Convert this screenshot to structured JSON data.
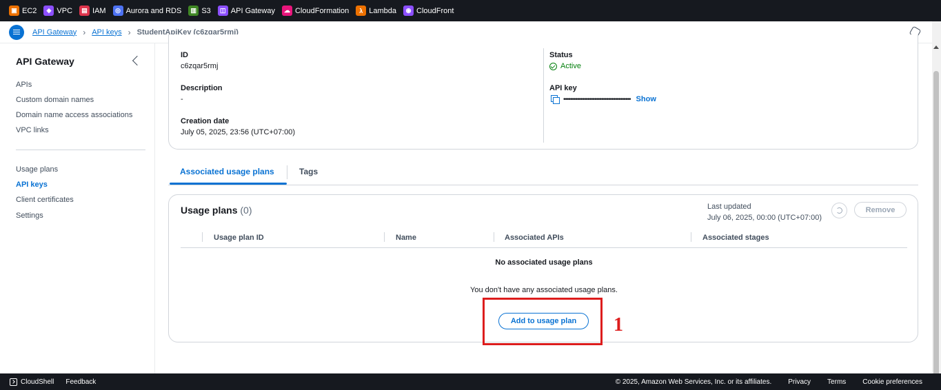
{
  "services": [
    {
      "label": "EC2",
      "icon": "ec2-icon",
      "color": "#ed7100"
    },
    {
      "label": "VPC",
      "icon": "vpc-icon",
      "color": "#8c4fff"
    },
    {
      "label": "IAM",
      "icon": "iam-icon",
      "color": "#dd344c"
    },
    {
      "label": "Aurora and RDS",
      "icon": "rds-icon",
      "color": "#4d72f3"
    },
    {
      "label": "S3",
      "icon": "s3-icon",
      "color": "#3f8624"
    },
    {
      "label": "API Gateway",
      "icon": "api-gateway-icon",
      "color": "#8c4fff"
    },
    {
      "label": "CloudFormation",
      "icon": "cloudformation-icon",
      "color": "#e7157b"
    },
    {
      "label": "Lambda",
      "icon": "lambda-icon",
      "color": "#ed7100"
    },
    {
      "label": "CloudFront",
      "icon": "cloudfront-icon",
      "color": "#8c4fff"
    }
  ],
  "breadcrumb": {
    "root": "API Gateway",
    "section": "API keys",
    "current": "StudentApiKey (c6zqar5rmj)"
  },
  "sidebar": {
    "title": "API Gateway",
    "group1": [
      "APIs",
      "Custom domain names",
      "Domain name access associations",
      "VPC links"
    ],
    "group2": [
      "Usage plans",
      "API keys",
      "Client certificates",
      "Settings"
    ],
    "active": "API keys"
  },
  "details": {
    "id_label": "ID",
    "id_value": "c6zqar5rmj",
    "description_label": "Description",
    "description_value": "-",
    "creation_label": "Creation date",
    "creation_value": "July 05, 2025, 23:56 (UTC+07:00)",
    "status_label": "Status",
    "status_value": "Active",
    "apikey_label": "API key",
    "apikey_masked": "•••••••••••••••••••••••••••••••••••••••",
    "show_label": "Show"
  },
  "tabs": [
    {
      "label": "Associated usage plans",
      "active": true
    },
    {
      "label": "Tags",
      "active": false
    }
  ],
  "usage_plans": {
    "title": "Usage plans",
    "count": "(0)",
    "last_updated_label": "Last updated",
    "last_updated_value": "July 06, 2025, 00:00 (UTC+07:00)",
    "remove_label": "Remove",
    "columns": [
      "Usage plan ID",
      "Name",
      "Associated APIs",
      "Associated stages"
    ],
    "empty_title": "No associated usage plans",
    "empty_desc": "You don't have any associated usage plans.",
    "add_label": "Add to usage plan"
  },
  "annotation": {
    "number": "1",
    "color": "#dd1d1d"
  },
  "footer": {
    "cloudshell": "CloudShell",
    "feedback": "Feedback",
    "copyright": "© 2025, Amazon Web Services, Inc. or its affiliates.",
    "privacy": "Privacy",
    "terms": "Terms",
    "cookies": "Cookie preferences"
  }
}
